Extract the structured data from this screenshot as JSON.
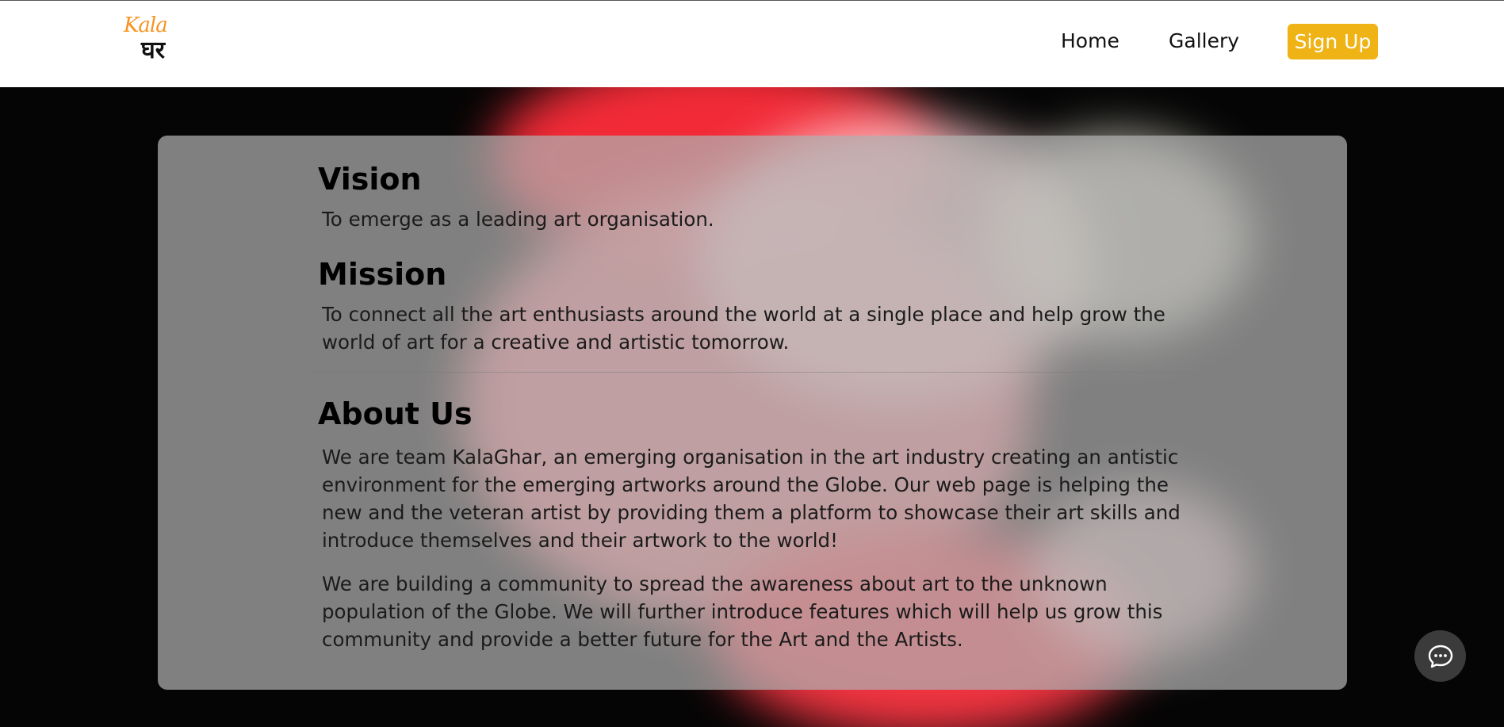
{
  "header": {
    "logo_top": "Kala",
    "logo_bottom": "घर",
    "nav": {
      "home": "Home",
      "gallery": "Gallery",
      "signup": "Sign Up"
    }
  },
  "colors": {
    "accent": "#efb316",
    "logo_orange": "#f7931e"
  },
  "content": {
    "vision": {
      "heading": "Vision",
      "text": "To emerge as a leading art organisation."
    },
    "mission": {
      "heading": "Mission",
      "text": "To connect all the art enthusiasts around the world at a single place and help grow the world of art for a creative and artistic tomorrow."
    },
    "about": {
      "heading": "About Us",
      "paragraph1": "We are team KalaGhar, an emerging organisation in the art industry creating an antistic environment for the emerging artworks around the Globe. Our web page is helping the new and the veteran artist by providing them a platform to showcase their art skills and introduce themselves and their artwork to the world!",
      "paragraph2": "We are building a community to spread the awareness about art to the unknown population of the Globe. We will further introduce features which will help us grow this community and provide a better future for the Art and the Artists."
    }
  },
  "chat": {
    "icon": "chat-bubble-icon"
  }
}
